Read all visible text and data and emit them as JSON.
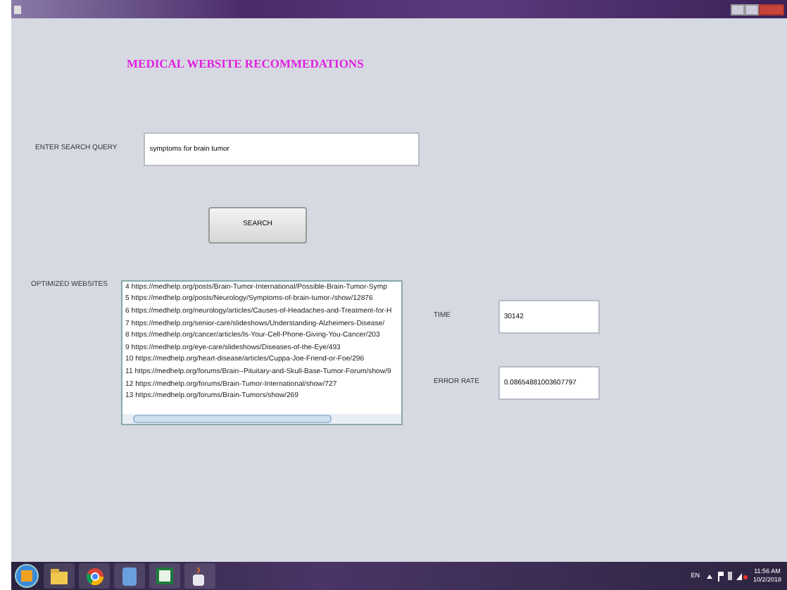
{
  "heading": "MEDICAL WEBSITE RECOMMEDATIONS",
  "query": {
    "label": "ENTER SEARCH QUERY",
    "value": "symptoms for brain tumor"
  },
  "search_button": "SEARCH",
  "results": {
    "label": "OPTIMIZED WEBSITES",
    "items": [
      "4 https://medhelp.org/posts/Brain-Tumor-International/Possible-Brain-Tumor-Symp",
      "5 https://medhelp.org/posts/Neurology/Symptoms-of-brain-tumor-/show/12876",
      "6 https://medhelp.org/neurology/articles/Causes-of-Headaches-and-Treatment-for-H",
      "7 https://medhelp.org/senior-care/slideshows/Understanding-Alzheimers-Disease/",
      "8 https://medhelp.org/cancer/articles/Is-Your-Cell-Phone-Giving-You-Cancer/203",
      "9 https://medhelp.org/eye-care/slideshows/Diseases-of-the-Eye/493",
      "10 https://medhelp.org/heart-disease/articles/Cuppa-Joe-Friend-or-Foe/296",
      "11 https://medhelp.org/forums/Brain--Pituitary-and-Skull-Base-Tumor-Forum/show/9",
      "12 https://medhelp.org/forums/Brain-Tumor-International/show/727",
      "13 https://medhelp.org/forums/Brain-Tumors/show/269"
    ]
  },
  "metrics": [
    {
      "label": "TIME",
      "value": "30142"
    },
    {
      "label": "ERROR RATE",
      "value": "0.08654881003607797"
    }
  ],
  "taskbar": {
    "language": "EN",
    "time": "11:56 AM",
    "date": "10/2/2018"
  }
}
